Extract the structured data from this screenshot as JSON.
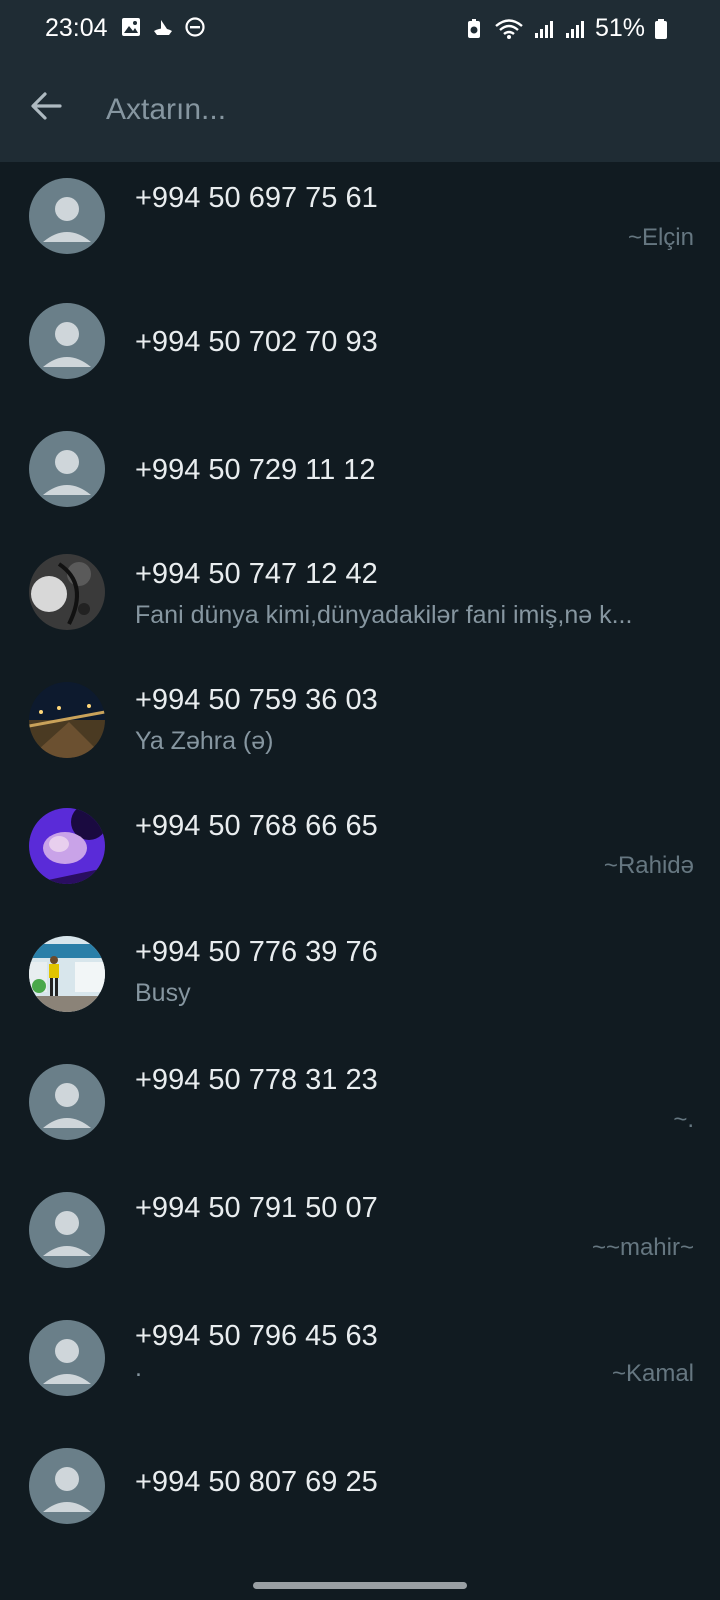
{
  "status_bar": {
    "time": "23:04",
    "battery": "51%",
    "icons_left": [
      "gallery-icon",
      "ship-icon",
      "do-not-disturb-icon"
    ],
    "icons_right": [
      "battery-saver-icon",
      "wifi-icon",
      "signal-icon",
      "signal-icon",
      "battery-icon"
    ]
  },
  "app_bar": {
    "search_placeholder": "Axtarın..."
  },
  "colors": {
    "background": "#111b21",
    "app_bar": "#1f2c34",
    "primary_text": "#e9edef",
    "secondary_text": "#8696a0",
    "default_avatar_bg": "#6a7f89"
  },
  "contacts": [
    {
      "phone": "+994 50 697 75 61",
      "about": "",
      "push_name": "~Elçin",
      "avatar": "default"
    },
    {
      "phone": "+994 50 702 70 93",
      "about": "",
      "push_name": "",
      "avatar": "default"
    },
    {
      "phone": "+994 50 729 11 12",
      "about": "",
      "push_name": "",
      "avatar": "default"
    },
    {
      "phone": "+994 50 747 12 42",
      "about": "Fani dünya kimi,dünyadakilər fani imiş,nə k...",
      "push_name": "",
      "avatar": "photo-bw"
    },
    {
      "phone": "+994 50 759 36 03",
      "about": "Ya Zəhra (ə)",
      "push_name": "",
      "avatar": "photo-night"
    },
    {
      "phone": "+994 50 768 66 65",
      "about": "",
      "push_name": "~Rahidə",
      "avatar": "photo-purple"
    },
    {
      "phone": "+994 50 776 39 76",
      "about": "Busy",
      "push_name": "",
      "avatar": "photo-person"
    },
    {
      "phone": "+994 50 778 31 23",
      "about": "",
      "push_name": "~.",
      "avatar": "default"
    },
    {
      "phone": "+994 50 791 50 07",
      "about": "",
      "push_name": "~~mahir~",
      "avatar": "default"
    },
    {
      "phone": "+994 50 796 45 63",
      "about": ".",
      "push_name": "~Kamal",
      "avatar": "default"
    },
    {
      "phone": "+994 50 807 69 25",
      "about": "",
      "push_name": "",
      "avatar": "default"
    }
  ]
}
